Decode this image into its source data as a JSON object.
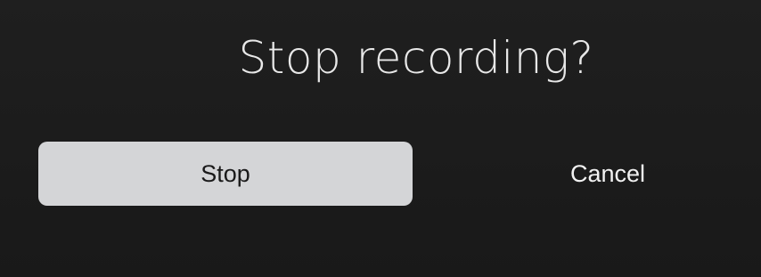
{
  "dialog": {
    "title": "Stop recording?",
    "primary_label": "Stop",
    "secondary_label": "Cancel"
  },
  "colors": {
    "background": "#1c1c1c",
    "primary_button_bg": "#d4d5d7",
    "primary_button_text": "#1a1a1a",
    "title_text": "#e8e8e8",
    "secondary_text": "#f2f2f2"
  }
}
